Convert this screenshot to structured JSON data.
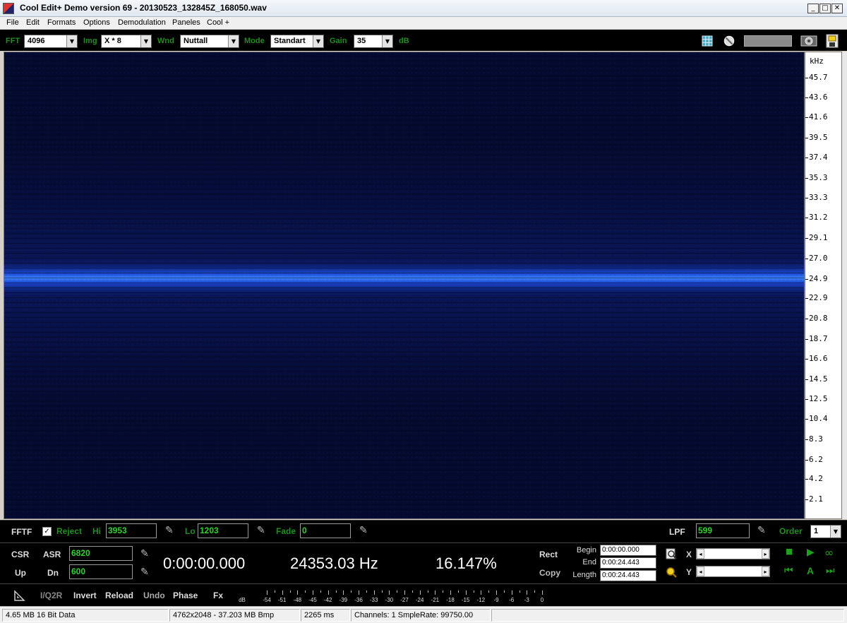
{
  "window": {
    "title": "Cool Edit+ Demo version 69 - 20130523_132845Z_168050.wav",
    "minimize_glyph": "_",
    "maximize_glyph": "□",
    "close_glyph": "✕"
  },
  "menu": [
    "File",
    "Edit",
    "Formats",
    "Options",
    "Demodulation",
    "Paneles",
    "Cool +"
  ],
  "toolbar": {
    "fft_label": "FFT",
    "fft_value": "4096",
    "img_label": "Img",
    "img_value": "X * 8",
    "wnd_label": "Wnd",
    "wnd_value": "Nuttall",
    "mode_label": "Mode",
    "mode_value": "Standart",
    "gain_label": "Gain",
    "gain_value": "35",
    "gain_unit": "dB",
    "icons": [
      "grid-icon",
      "no-sign-icon",
      "progress-slot",
      "speaker-icon",
      "save-disk-icon"
    ]
  },
  "spectrogram": {
    "background_color": "#050a30",
    "band_color": "#2a6cff",
    "band_center_khz": 24.9
  },
  "axis": {
    "unit": "kHz",
    "max_khz": 48.3,
    "min_khz": 0,
    "ticks": [
      "45.7",
      "43.6",
      "41.6",
      "39.5",
      "37.4",
      "35.3",
      "33.3",
      "31.2",
      "29.1",
      "27.0",
      "24.9",
      "22.9",
      "20.8",
      "18.7",
      "16.6",
      "14.5",
      "12.5",
      "10.4",
      "8.3",
      "6.2",
      "4.2",
      "2.1"
    ]
  },
  "filterbar": {
    "fftf_label": "FFTF",
    "reject_checked": "✓",
    "reject_label": "Reject",
    "hi_label": "Hi",
    "hi_value": "3953",
    "lo_label": "Lo",
    "lo_value": "1203",
    "fade_label": "Fade",
    "fade_value": "0",
    "lpf_label": "LPF",
    "lpf_value": "599",
    "order_label": "Order",
    "order_value": "1"
  },
  "panel": {
    "csr_label": "CSR",
    "asr_label": "ASR",
    "asr_value": "6820",
    "up_label": "Up",
    "dn_label": "Dn",
    "dn_value": "600",
    "time": "0:00:00.000",
    "frequency": "24353.03 Hz",
    "percent": "16.147%",
    "rect_label": "Rect",
    "copy_label": "Copy",
    "begin_label": "Begin",
    "begin_value": "0:00:00.000",
    "end_label": "End",
    "end_value": "0:00:24.443",
    "length_label": "Length",
    "length_value": "0:00:24.443",
    "x_label": "X",
    "y_label": "Y",
    "slider_left": "◂",
    "slider_right": "▸",
    "play_stop": "■",
    "play": "▶",
    "loop": "∞",
    "skip_back": "⏮",
    "a_label": "A",
    "skip_fwd": "⏭"
  },
  "bottombar": {
    "iq2r": "I/Q2R",
    "invert": "Invert",
    "reload": "Reload",
    "undo": "Undo",
    "phase": "Phase",
    "fx": "Fx",
    "meter_unit": "dB",
    "meter_ticks": [
      "-54",
      "-51",
      "-48",
      "-45",
      "-42",
      "-39",
      "-36",
      "-33",
      "-30",
      "-27",
      "-24",
      "-21",
      "-18",
      "-15",
      "-12",
      "-9",
      "-6",
      "-3",
      "0"
    ]
  },
  "status": {
    "size": "4.65 MB 16 Bit Data",
    "image": "4762x2048 - 37.203 MB Bmp",
    "time": "2265 ms",
    "channels": "Channels: 1  SmpleRate: 99750.00"
  }
}
